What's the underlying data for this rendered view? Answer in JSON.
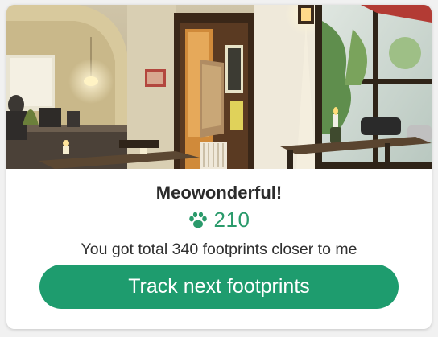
{
  "card": {
    "photo_alt": "Cafe interior photo",
    "title": "Meowonderful!",
    "points": "210",
    "paw_icon": "paw-icon",
    "subtitle": "You got total 340 footprints closer to me",
    "cta_label": "Track next footprints"
  },
  "colors": {
    "accent": "#1e9c6e",
    "points_text": "#2a9a6b",
    "title_text": "#2b2b2b"
  }
}
